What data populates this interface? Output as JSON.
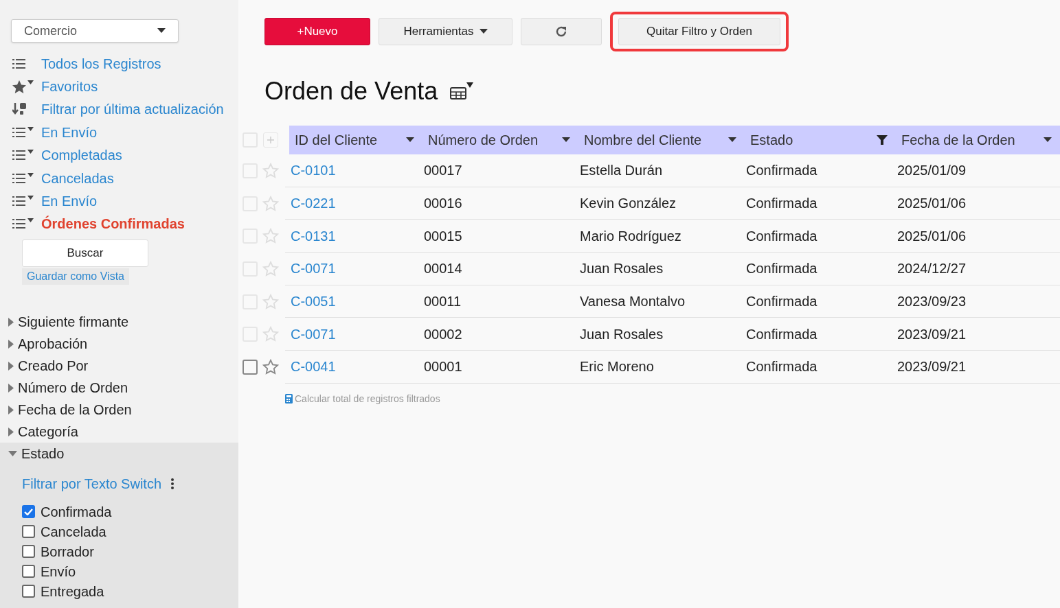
{
  "app_selector": {
    "value": "Comercio"
  },
  "views": [
    {
      "label": "Todos los Registros",
      "kind": "list",
      "selected": false
    },
    {
      "label": "Favoritos",
      "kind": "star",
      "selected": false
    },
    {
      "label": "Filtrar por última actualización",
      "kind": "sort",
      "selected": false
    },
    {
      "label": "En Envío",
      "kind": "filter",
      "selected": false
    },
    {
      "label": "Completadas",
      "kind": "filter",
      "selected": false
    },
    {
      "label": "Canceladas",
      "kind": "filter",
      "selected": false
    },
    {
      "label": "En Envío",
      "kind": "filter",
      "selected": false
    },
    {
      "label": "Órdenes Confirmadas",
      "kind": "filter",
      "selected": true
    }
  ],
  "search_button": "Buscar",
  "save_view_link": "Guardar como Vista",
  "field_filters": [
    {
      "label": "Siguiente firmante",
      "expanded": false
    },
    {
      "label": "Aprobación",
      "expanded": false
    },
    {
      "label": "Creado Por",
      "expanded": false
    },
    {
      "label": "Número de Orden",
      "expanded": false
    },
    {
      "label": "Fecha de la Orden",
      "expanded": false
    },
    {
      "label": "Categoría",
      "expanded": false
    },
    {
      "label": "Estado",
      "expanded": true,
      "filter_mode": "Filtrar por Texto Switch",
      "options": [
        {
          "label": "Confirmada",
          "checked": true
        },
        {
          "label": "Cancelada",
          "checked": false
        },
        {
          "label": "Borrador",
          "checked": false
        },
        {
          "label": "Envío",
          "checked": false
        },
        {
          "label": "Entregada",
          "checked": false
        }
      ]
    }
  ],
  "toolbar": [
    {
      "kind": "primary",
      "label": "+Nuevo",
      "highlighted": false
    },
    {
      "kind": "menu",
      "label": "Herramientas",
      "highlighted": false
    },
    {
      "kind": "refresh",
      "highlighted": false
    },
    {
      "kind": "plain",
      "label": "Quitar Filtro y Orden",
      "highlighted": true
    }
  ],
  "title": "Orden de Venta",
  "table": {
    "select_all": {
      "checked": false
    },
    "columns": [
      {
        "label": "ID del Cliente",
        "filtered": false
      },
      {
        "label": "Número de Orden",
        "filtered": false
      },
      {
        "label": "Nombre del Cliente",
        "filtered": false
      },
      {
        "label": "Estado",
        "filtered": true
      },
      {
        "label": "Fecha de la Orden",
        "filtered": false
      }
    ],
    "rows": [
      {
        "cells": [
          "C-0101",
          "00017",
          "Estella Durán",
          "Confirmada",
          "2025/01/09"
        ],
        "checked": false,
        "hovered": false
      },
      {
        "cells": [
          "C-0221",
          "00016",
          "Kevin González",
          "Confirmada",
          "2025/01/06"
        ],
        "checked": false,
        "hovered": false
      },
      {
        "cells": [
          "C-0131",
          "00015",
          "Mario Rodríguez",
          "Confirmada",
          "2025/01/06"
        ],
        "checked": false,
        "hovered": false
      },
      {
        "cells": [
          "C-0071",
          "00014",
          "Juan Rosales",
          "Confirmada",
          "2024/12/27"
        ],
        "checked": false,
        "hovered": false
      },
      {
        "cells": [
          "C-0051",
          "00011",
          "Vanesa Montalvo",
          "Confirmada",
          "2023/09/23"
        ],
        "checked": false,
        "hovered": false
      },
      {
        "cells": [
          "C-0071",
          "00002",
          "Juan Rosales",
          "Confirmada",
          "2023/09/21"
        ],
        "checked": false,
        "hovered": false
      },
      {
        "cells": [
          "C-0041",
          "00001",
          "Eric Moreno",
          "Confirmada",
          "2023/09/21"
        ],
        "checked": false,
        "hovered": true
      }
    ]
  },
  "calc_total_link": "Calcular total de registros filtrados"
}
